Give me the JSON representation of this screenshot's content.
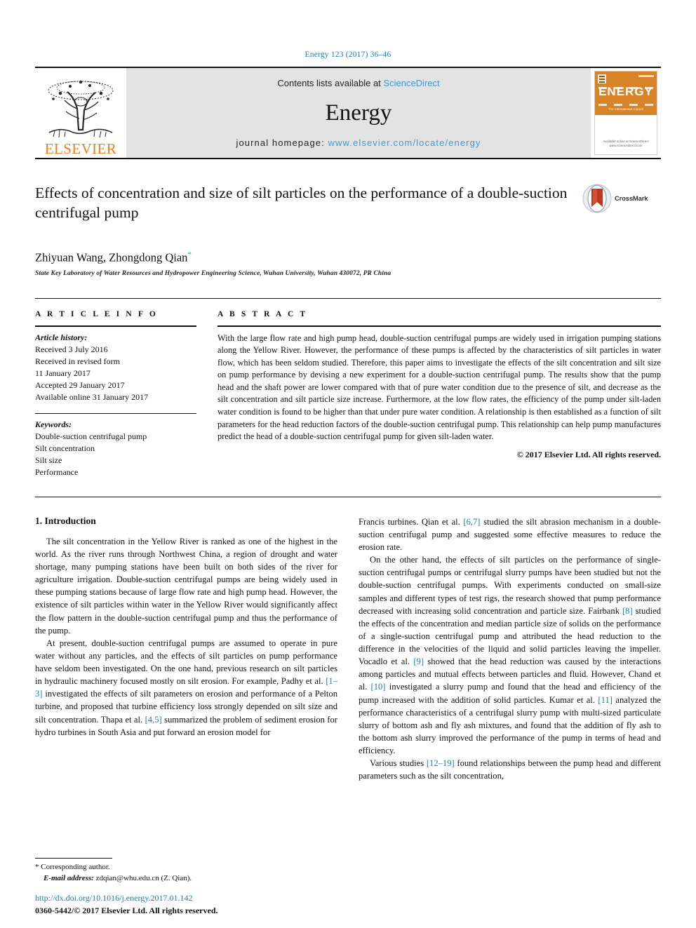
{
  "running_head": "Energy 123 (2017) 36–46",
  "masthead": {
    "publisher_name": "ELSEVIER",
    "contents_prefix": "Contents lists available at",
    "sciencedirect": "ScienceDirect",
    "journal_name": "Energy",
    "homepage_label": "journal homepage:",
    "homepage_url": "www.elsevier.com/locate/energy",
    "cover_title": "ENERGY",
    "cover_subtitle": "The International Journal",
    "cover_footer": "Available online at\nScienceDirect\nwww.sciencedirect.com",
    "link_color": "#3a9ad9",
    "elsevier_orange": "#ef7d22",
    "banner_bg": "#e3e3e3"
  },
  "article": {
    "title": "Effects of concentration and size of silt particles on the performance of a double-suction centrifugal pump",
    "authors": "Zhiyuan Wang, Zhongdong Qian",
    "corresponding_marker": "*",
    "affiliation": "State Key Laboratory of Water Resources and Hydropower Engineering Science, Wuhan University, Wuhan 430072, PR China",
    "crossmark_label": "CrossMark"
  },
  "info": {
    "heading": "A R T I C L E   I N F O",
    "history_label": "Article history:",
    "history": [
      "Received 3 July 2016",
      "Received in revised form",
      "11 January 2017",
      "Accepted 29 January 2017",
      "Available online 31 January 2017"
    ],
    "keywords_label": "Keywords:",
    "keywords": [
      "Double-suction centrifugal pump",
      "Silt concentration",
      "Silt size",
      "Performance"
    ]
  },
  "abstract": {
    "heading": "A B S T R A C T",
    "text": "With the large flow rate and high pump head, double-suction centrifugal pumps are widely used in irrigation pumping stations along the Yellow River. However, the performance of these pumps is affected by the characteristics of silt particles in water flow, which has been seldom studied. Therefore, this paper aims to investigate the effects of the silt concentration and silt size on pump performance by devising a new experiment for a double-suction centrifugal pump. The results show that the pump head and the shaft power are lower compared with that of pure water condition due to the presence of silt, and decrease as the silt concentration and silt particle size increase. Furthermore, at the low flow rates, the efficiency of the pump under silt-laden water condition is found to be higher than that under pure water condition. A relationship is then established as a function of silt parameters for the head reduction factors of the double-suction centrifugal pump. This relationship can help pump manufactures predict the head of a double-suction centrifugal pump for given silt-laden water.",
    "copyright": "© 2017 Elsevier Ltd. All rights reserved."
  },
  "body": {
    "section_title": "1. Introduction",
    "left_paragraphs": [
      "The silt concentration in the Yellow River is ranked as one of the highest in the world. As the river runs through Northwest China, a region of drought and water shortage, many pumping stations have been built on both sides of the river for agriculture irrigation. Double-suction centrifugal pumps are being widely used in these pumping stations because of large flow rate and high pump head. However, the existence of silt particles within water in the Yellow River would significantly affect the flow pattern in the double-suction centrifugal pump and thus the performance of the pump."
    ],
    "left_paragraph_2_parts": [
      {
        "t": "At present, double-suction centrifugal pumps are assumed to operate in pure water without any particles, and the effects of silt particles on pump performance have seldom been investigated. On the one hand, previous research on silt particles in hydraulic machinery focused mostly on silt erosion. For example, Padhy et al. ",
        "cite": false
      },
      {
        "t": "[1–3]",
        "cite": true
      },
      {
        "t": " investigated the effects of silt parameters on erosion and performance of a Pelton turbine, and proposed that turbine efficiency loss strongly depended on silt size and silt concentration. Thapa et al. ",
        "cite": false
      },
      {
        "t": "[4,5]",
        "cite": true
      },
      {
        "t": " summarized the problem of sediment erosion for hydro turbines in South Asia and put forward an erosion model for",
        "cite": false
      }
    ],
    "right_paragraph_1_parts": [
      {
        "t": "Francis turbines. Qian et al. ",
        "cite": false
      },
      {
        "t": "[6,7]",
        "cite": true
      },
      {
        "t": " studied the silt abrasion mechanism in a double-suction centrifugal pump and suggested some effective measures to reduce the erosion rate.",
        "cite": false
      }
    ],
    "right_paragraph_2_parts": [
      {
        "t": "On the other hand, the effects of silt particles on the performance of single-suction centrifugal pumps or centrifugal slurry pumps have been studied but not the double-suction centrifugal pumps. With experiments conducted on small-size samples and different types of test rigs, the research showed that pump performance decreased with increasing solid concentration and particle size. Fairbank ",
        "cite": false
      },
      {
        "t": "[8]",
        "cite": true
      },
      {
        "t": " studied the effects of the concentration and median particle size of solids on the performance of a single-suction centrifugal pump and attributed the head reduction to the difference in the velocities of the liquid and solid particles leaving the impeller. Vocadlo et al. ",
        "cite": false
      },
      {
        "t": "[9]",
        "cite": true
      },
      {
        "t": " showed that the head reduction was caused by the interactions among particles and mutual effects between particles and fluid. However, Chand et al. ",
        "cite": false
      },
      {
        "t": "[10]",
        "cite": true
      },
      {
        "t": " investigated a slurry pump and found that the head and efficiency of the pump increased with the addition of solid particles. Kumar et al. ",
        "cite": false
      },
      {
        "t": "[11]",
        "cite": true
      },
      {
        "t": " analyzed the performance characteristics of a centrifugal slurry pump with multi-sized particulate slurry of bottom ash and fly ash mixtures, and found that the addition of fly ash to the bottom ash slurry improved the performance of the pump in terms of head and efficiency.",
        "cite": false
      }
    ],
    "right_paragraph_3_parts": [
      {
        "t": "Various studies ",
        "cite": false
      },
      {
        "t": "[12–19]",
        "cite": true
      },
      {
        "t": " found relationships between the pump head and different parameters such as the silt concentration,",
        "cite": false
      }
    ]
  },
  "footnote": {
    "star": "*",
    "corresponding": "Corresponding author.",
    "email_label": "E-mail address:",
    "email": "zdqian@whu.edu.cn",
    "email_suffix": "(Z. Qian)."
  },
  "footer": {
    "doi": "http://dx.doi.org/10.1016/j.energy.2017.01.142",
    "issn": "0360-5442/© 2017 Elsevier Ltd. All rights reserved."
  }
}
